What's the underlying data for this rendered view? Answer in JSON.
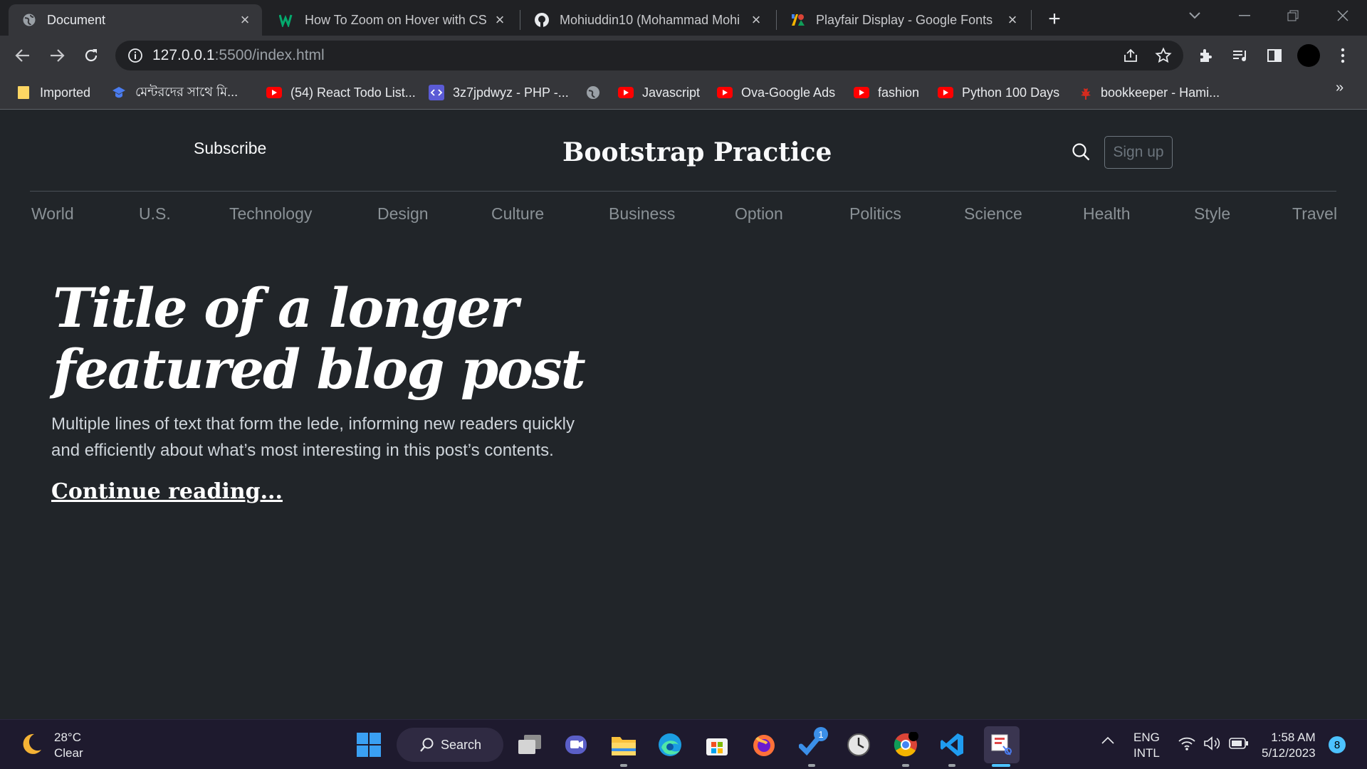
{
  "browser": {
    "tabs": [
      {
        "title": "Document",
        "icon": "globe-icon"
      },
      {
        "title": "How To Zoom on Hover with CSS",
        "icon": "w3schools-icon"
      },
      {
        "title": "Mohiuddin10 (Mohammad Mohi",
        "icon": "github-icon"
      },
      {
        "title": "Playfair Display - Google Fonts",
        "icon": "google-fonts-icon"
      }
    ],
    "url_host": "127.0.0.1",
    "url_rest": ":5500/index.html",
    "bookmarks": [
      {
        "label": "Imported",
        "icon": "folder-icon"
      },
      {
        "label": "মেন্টরদের সাথে মি...",
        "icon": "mentor-icon"
      },
      {
        "label": "(54) React Todo List...",
        "icon": "youtube-icon"
      },
      {
        "label": "3z7jpdwyz - PHP -...",
        "icon": "code-icon"
      },
      {
        "label": "",
        "icon": "globe-icon"
      },
      {
        "label": "Javascript",
        "icon": "youtube-icon"
      },
      {
        "label": "Ova-Google Ads",
        "icon": "youtube-icon"
      },
      {
        "label": "fashion",
        "icon": "youtube-icon"
      },
      {
        "label": "Python 100 Days",
        "icon": "youtube-icon"
      },
      {
        "label": "bookkeeper - Hami...",
        "icon": "maple-leaf-icon"
      }
    ],
    "bookmarks_more": "»"
  },
  "header": {
    "subscribe": "Subscribe",
    "brand": "Bootstrap Practice",
    "signup": "Sign up"
  },
  "nav": [
    "World",
    "U.S.",
    "Technology",
    "Design",
    "Culture",
    "Business",
    "Option",
    "Politics",
    "Science",
    "Health",
    "Style",
    "Travel"
  ],
  "hero": {
    "title_line1": "Title of a longer",
    "title_line2": "featured blog post",
    "lede_line1": "Multiple lines of text that form the lede, informing new readers quickly",
    "lede_line2": "and efficiently about what’s most interesting in this post’s contents.",
    "link": "Continue reading..."
  },
  "taskbar": {
    "weather_temp": "28°C",
    "weather_desc": "Clear",
    "search": "Search",
    "lang_line1": "ENG",
    "lang_line2": "INTL",
    "time": "1:58 AM",
    "date": "5/12/2023",
    "notifications": "8",
    "badge_count": "1"
  },
  "colors": {
    "page_bg": "#212529",
    "taskbar_bg": "#1e1a2e",
    "nav_text": "#8a9196",
    "accent": "#4cc2ff"
  }
}
